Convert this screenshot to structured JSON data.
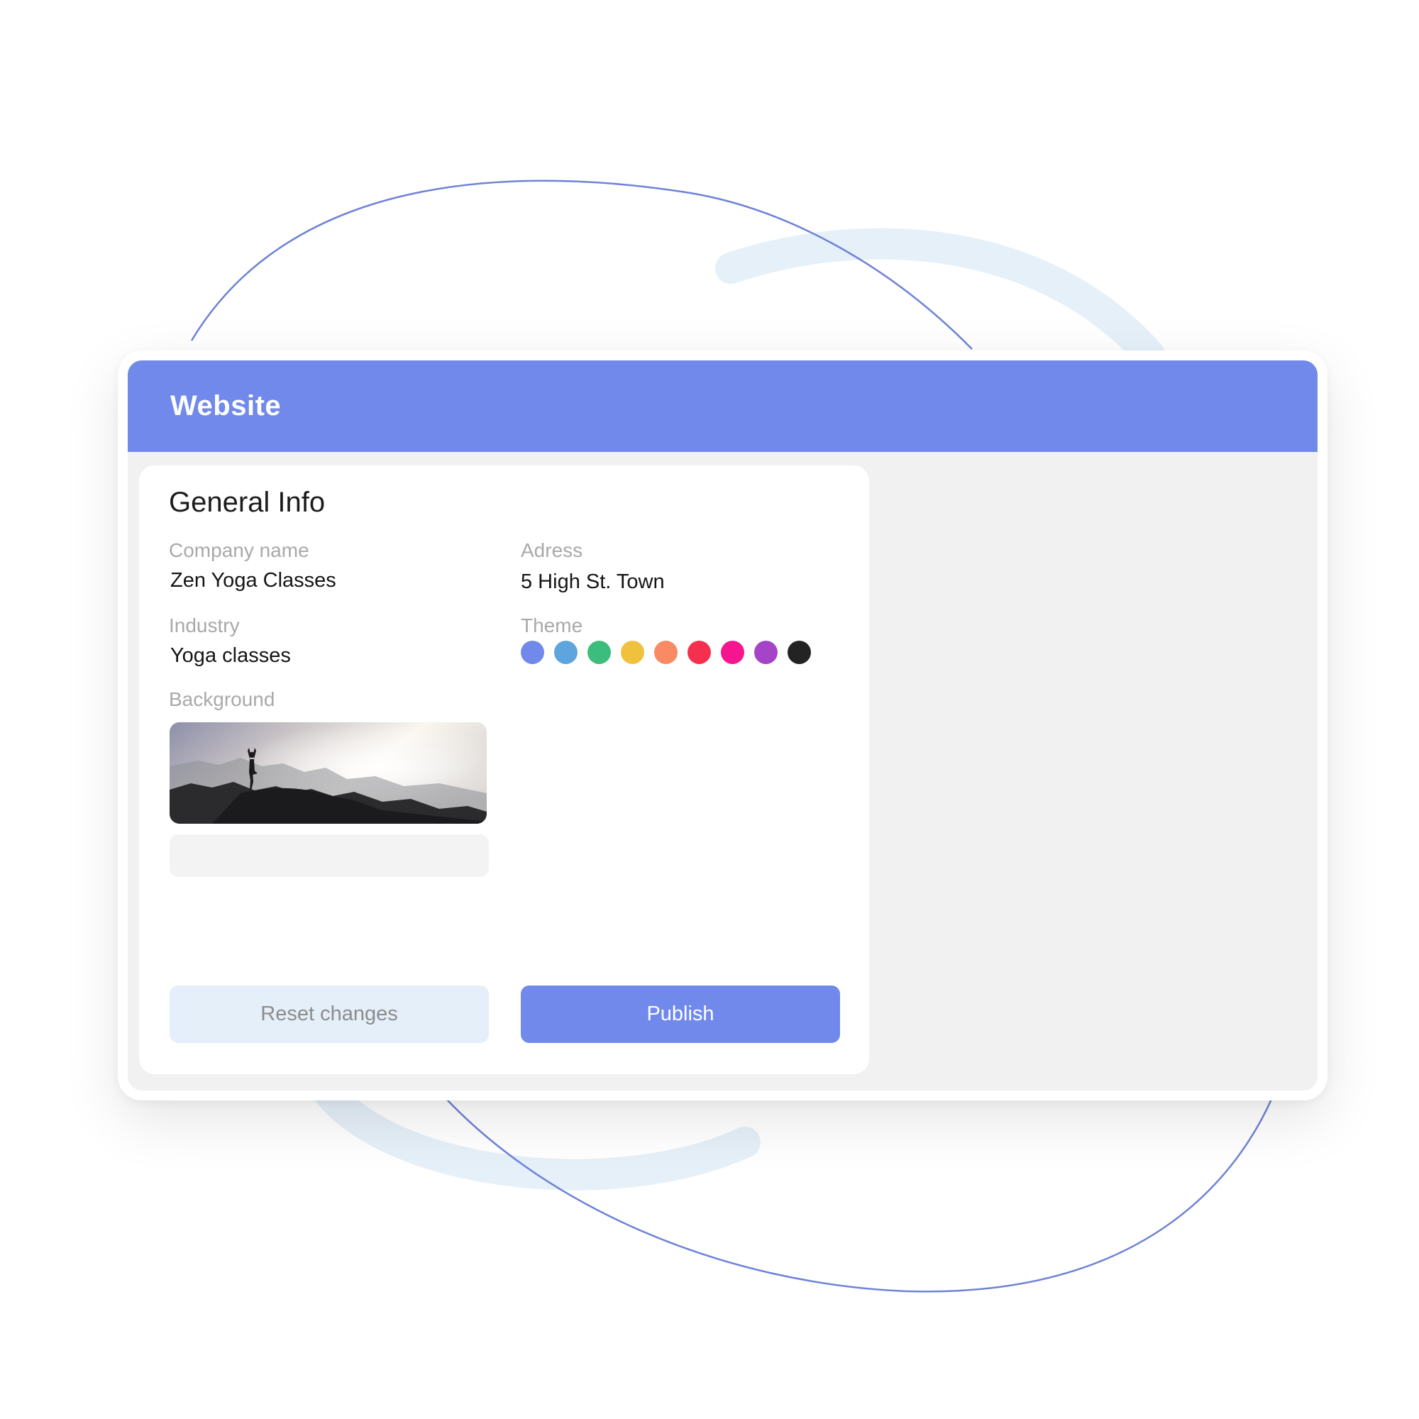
{
  "window": {
    "title": "Website"
  },
  "general_info": {
    "heading": "General Info",
    "company_name": {
      "label": "Company name",
      "value": "Zen Yoga Classes"
    },
    "address": {
      "label": "Adress",
      "value": "5 High St. Town"
    },
    "industry": {
      "label": "Industry",
      "value": "Yoga classes"
    },
    "theme": {
      "label": "Theme",
      "colors": [
        "#7089ea",
        "#5da5dc",
        "#3dbd7d",
        "#f0c13c",
        "#f98a64",
        "#f5304f",
        "#f5168f",
        "#a544c9",
        "#232323"
      ]
    },
    "background": {
      "label": "Background",
      "image": "yoga-silhouette-mountain-photo",
      "filename": ""
    }
  },
  "actions": {
    "reset_label": "Reset changes",
    "publish_label": "Publish"
  },
  "colors": {
    "accent": "#7089ea",
    "panel_background": "#f1f1f1",
    "reset_button": "#e5eff9"
  }
}
